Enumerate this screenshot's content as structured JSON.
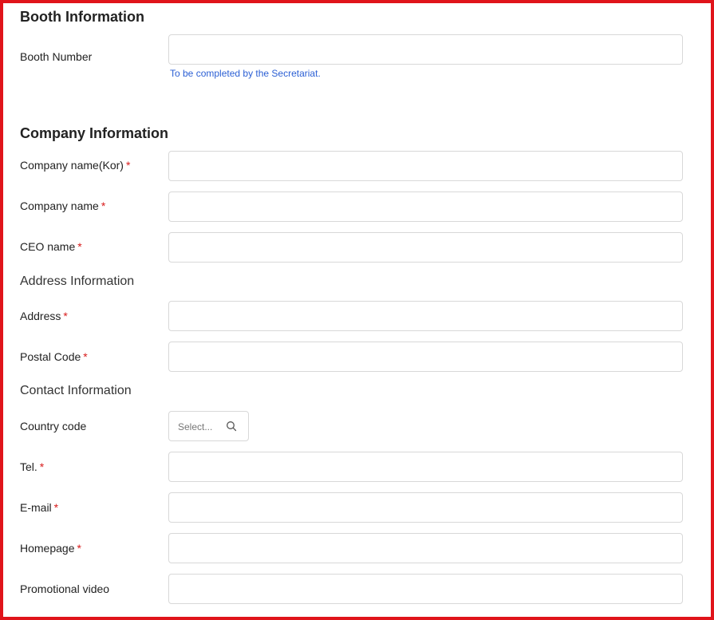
{
  "booth": {
    "title": "Booth Information",
    "booth_number_label": "Booth Number",
    "hint": "To be completed by the Secretariat."
  },
  "company": {
    "title": "Company Information",
    "company_name_kor_label": "Company name(Kor)",
    "company_name_label": "Company name",
    "ceo_name_label": "CEO name"
  },
  "address": {
    "title": "Address Information",
    "address_label": "Address",
    "postal_code_label": "Postal Code"
  },
  "contact": {
    "title": "Contact Information",
    "country_code_label": "Country code",
    "country_code_placeholder": "Select...",
    "tel_label": "Tel.",
    "email_label": "E-mail",
    "homepage_label": "Homepage",
    "promo_video_label": "Promotional video"
  },
  "required_mark": "*",
  "colors": {
    "highlight_border": "#e0141b",
    "required": "#d81b1b",
    "hint": "#2b5fd4"
  }
}
